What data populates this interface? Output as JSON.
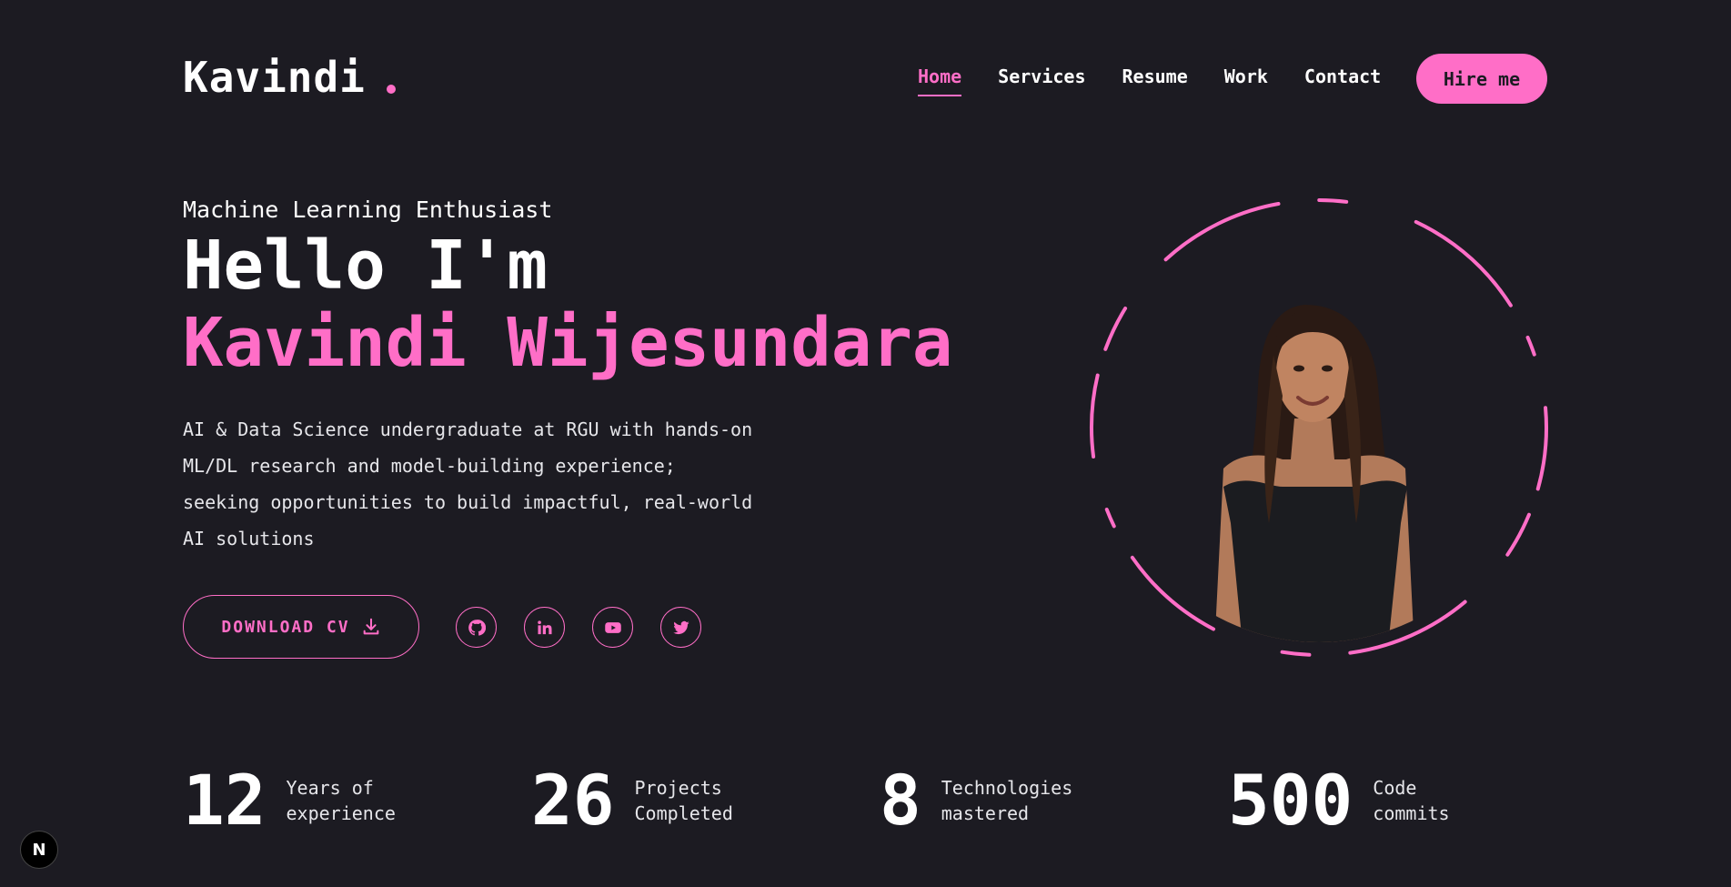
{
  "header": {
    "logo": "Kavindi",
    "nav": [
      {
        "label": "Home",
        "active": true
      },
      {
        "label": "Services",
        "active": false
      },
      {
        "label": "Resume",
        "active": false
      },
      {
        "label": "Work",
        "active": false
      },
      {
        "label": "Contact",
        "active": false
      }
    ],
    "hire_label": "Hire me"
  },
  "hero": {
    "subtitle": "Machine Learning Enthusiast",
    "greeting": "Hello I'm",
    "name": "Kavindi Wijesundara",
    "bio_lines": [
      "AI & Data Science undergraduate at RGU with hands-on",
      "ML/DL research and model-building experience;",
      "seeking opportunities to build impactful, real-world",
      "AI solutions"
    ],
    "cv_label": "DOWNLOAD CV",
    "socials": [
      "github-icon",
      "linkedin-icon",
      "youtube-icon",
      "twitter-icon"
    ]
  },
  "stats": [
    {
      "num": "12",
      "label1": "Years of",
      "label2": "experience"
    },
    {
      "num": "26",
      "label1": "Projects",
      "label2": "Completed"
    },
    {
      "num": "8",
      "label1": "Technologies",
      "label2": "mastered"
    },
    {
      "num": "500",
      "label1": "Code",
      "label2": "commits"
    }
  ],
  "badge": "N",
  "colors": {
    "accent": "#ff6ec7",
    "background": "#1c1b22"
  }
}
